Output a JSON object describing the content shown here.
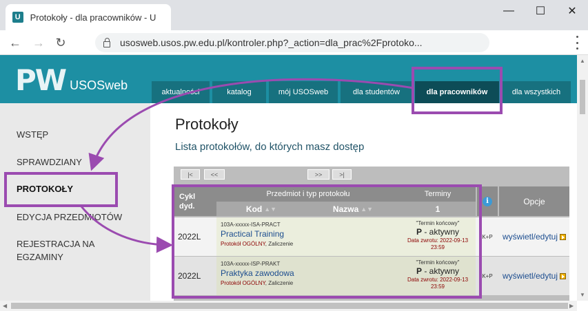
{
  "browser": {
    "tab_title": "Protokoły - dla pracowników - U",
    "favicon_letter": "U",
    "url": "usosweb.usos.pw.edu.pl/kontroler.php?_action=dla_prac%2Fprotoko..."
  },
  "site": {
    "logo_text": "USOSweb",
    "logo_mark": "PW",
    "nav": [
      {
        "label": "aktualności"
      },
      {
        "label": "katalog"
      },
      {
        "label": "mój USOSweb"
      },
      {
        "label": "dla studentów"
      },
      {
        "label": "dla pracowników",
        "active": true
      },
      {
        "label": "dla wszystkich"
      }
    ]
  },
  "sidebar": {
    "items": [
      {
        "label": "WSTĘP"
      },
      {
        "label": "SPRAWDZIANY"
      },
      {
        "label": "PROTOKOŁY",
        "active": true
      },
      {
        "label": "EDYCJA PRZEDMIOTÓW"
      },
      {
        "label": "REJESTRACJA NA EGZAMINY"
      }
    ]
  },
  "main": {
    "title": "Protokoły",
    "subtitle": "Lista protokołów, do których masz dostęp",
    "pager": {
      "first": "|<",
      "prev": "<<",
      "next": ">>",
      "last": ">|"
    },
    "headers": {
      "cycle": "Cykl dyd.",
      "subject_group": "Przedmiot i typ protokołu",
      "terms_group": "Terminy",
      "code": "Kod",
      "name": "Nazwa",
      "term_number": "1",
      "info": "i",
      "options": "Opcje"
    },
    "rows": [
      {
        "cycle": "2022L",
        "code": "103A-xxxxx-ISA-PRACT",
        "name": "Practical Training",
        "type_prefix": "Protokół OGÓLNY",
        "type_suffix": ", Zaliczenie",
        "term_name": "\"Termin końcowy\"",
        "status_letter": "P",
        "status_text": " - aktywny",
        "return_date": "Data zwrotu: 2022-09-13 23:59",
        "kp": "K+P",
        "option": "wyświetl/edytuj"
      },
      {
        "cycle": "2022L",
        "code": "103A-xxxxx-ISP-PRAKT",
        "name": "Praktyka zawodowa",
        "type_prefix": "Protokół OGÓLNY",
        "type_suffix": ", Zaliczenie",
        "term_name": "\"Termin końcowy\"",
        "status_letter": "P",
        "status_text": " - aktywny",
        "return_date": "Data zwrotu: 2022-09-13 23:59",
        "kp": "K+P",
        "option": "wyświetl/edytuj"
      }
    ]
  },
  "colors": {
    "header_teal": "#1d8fa3",
    "nav_tab": "#17717f",
    "nav_active": "#0d4c57",
    "annotation_purple": "#9b4bb0"
  },
  "icons": [
    "lock-icon",
    "back-arrow-icon",
    "forward-arrow-icon",
    "reload-icon",
    "info-icon",
    "external-link-icon",
    "minimize-icon",
    "maximize-icon",
    "close-icon"
  ]
}
